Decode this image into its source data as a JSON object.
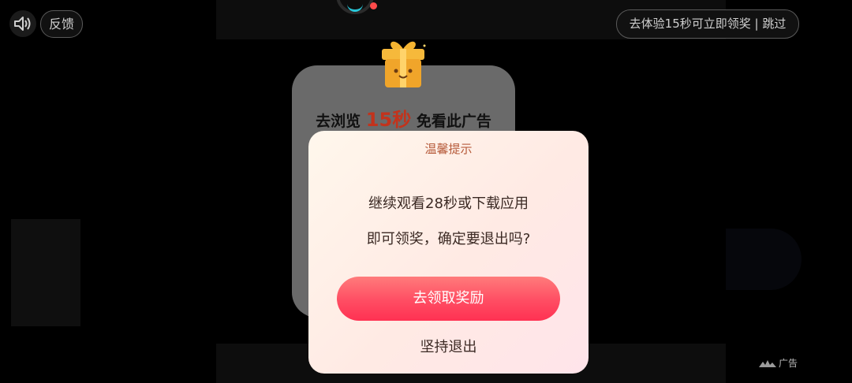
{
  "topbar": {
    "feedback_label": "反馈",
    "skip_label": "去体验15秒可立即领奖 | 跳过"
  },
  "background_card": {
    "text_before": "去浏览",
    "highlight": "15秒",
    "text_after": "免看此广告"
  },
  "dialog": {
    "title": "温馨提示",
    "line1": "继续观看28秒或下载应用",
    "line2": "即可领奖，确定要退出吗?",
    "primary_label": "去领取奖励",
    "secondary_label": "坚持退出"
  },
  "ad_label": "广告",
  "colors": {
    "primary_button": "#ff4d63",
    "title": "#b65a3a",
    "loader_accent": "#29c7d9",
    "loader_dot": "#ff4b4b"
  },
  "icons": {
    "sound": "speaker-icon",
    "gift": "gift-box-icon",
    "ad": "ad-mark-icon"
  }
}
